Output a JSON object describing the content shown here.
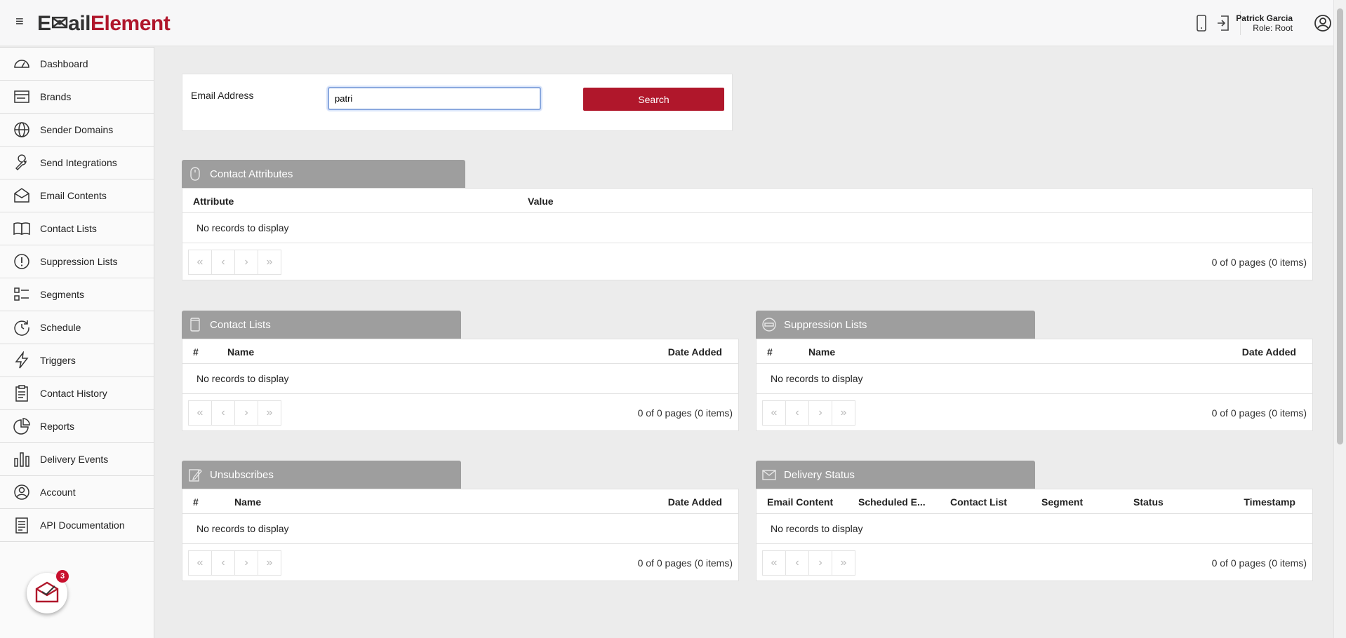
{
  "header": {
    "logo_part1": "E✉ail",
    "logo_part2": "Element",
    "user_name": "Patrick Garcia",
    "user_role": "Role: Root"
  },
  "sidebar": {
    "items": [
      {
        "label": "Dashboard",
        "icon": "dashboard-icon"
      },
      {
        "label": "Brands",
        "icon": "brands-icon"
      },
      {
        "label": "Sender Domains",
        "icon": "globe-icon"
      },
      {
        "label": "Send Integrations",
        "icon": "wrench-icon"
      },
      {
        "label": "Email Contents",
        "icon": "envelope-icon"
      },
      {
        "label": "Contact Lists",
        "icon": "book-icon"
      },
      {
        "label": "Suppression Lists",
        "icon": "alert-icon"
      },
      {
        "label": "Segments",
        "icon": "segments-icon"
      },
      {
        "label": "Schedule",
        "icon": "clock-icon"
      },
      {
        "label": "Triggers",
        "icon": "bolt-icon"
      },
      {
        "label": "Contact History",
        "icon": "clipboard-icon"
      },
      {
        "label": "Reports",
        "icon": "pie-icon"
      },
      {
        "label": "Delivery Events",
        "icon": "bar-chart-icon"
      },
      {
        "label": "Account",
        "icon": "user-circle-icon"
      },
      {
        "label": "API Documentation",
        "icon": "document-icon"
      }
    ],
    "notification_count": "3"
  },
  "search": {
    "label": "Email Address",
    "value": "patri",
    "button_label": "Search"
  },
  "panels": {
    "contact_attributes": {
      "title": "Contact Attributes",
      "columns": [
        "Attribute",
        "Value"
      ],
      "empty": "No records to display",
      "pager": "0 of 0 pages (0 items)"
    },
    "contact_lists": {
      "title": "Contact Lists",
      "columns": [
        "#",
        "Name",
        "Date Added"
      ],
      "empty": "No records to display",
      "pager": "0 of 0 pages (0 items)"
    },
    "suppression_lists": {
      "title": "Suppression Lists",
      "columns": [
        "#",
        "Name",
        "Date Added"
      ],
      "empty": "No records to display",
      "pager": "0 of 0 pages (0 items)"
    },
    "unsubscribes": {
      "title": "Unsubscribes",
      "columns": [
        "#",
        "Name",
        "Date Added"
      ],
      "empty": "No records to display",
      "pager": "0 of 0 pages (0 items)"
    },
    "delivery_status": {
      "title": "Delivery Status",
      "columns": [
        "Email Content",
        "Scheduled E...",
        "Contact List",
        "Segment",
        "Status",
        "Timestamp"
      ],
      "empty": "No records to display",
      "pager": "0 of 0 pages (0 items)"
    }
  },
  "pager_symbols": [
    "«",
    "‹",
    "›",
    "»"
  ],
  "colors": {
    "brand_red": "#b0172b",
    "panel_header": "#9e9e9e"
  }
}
